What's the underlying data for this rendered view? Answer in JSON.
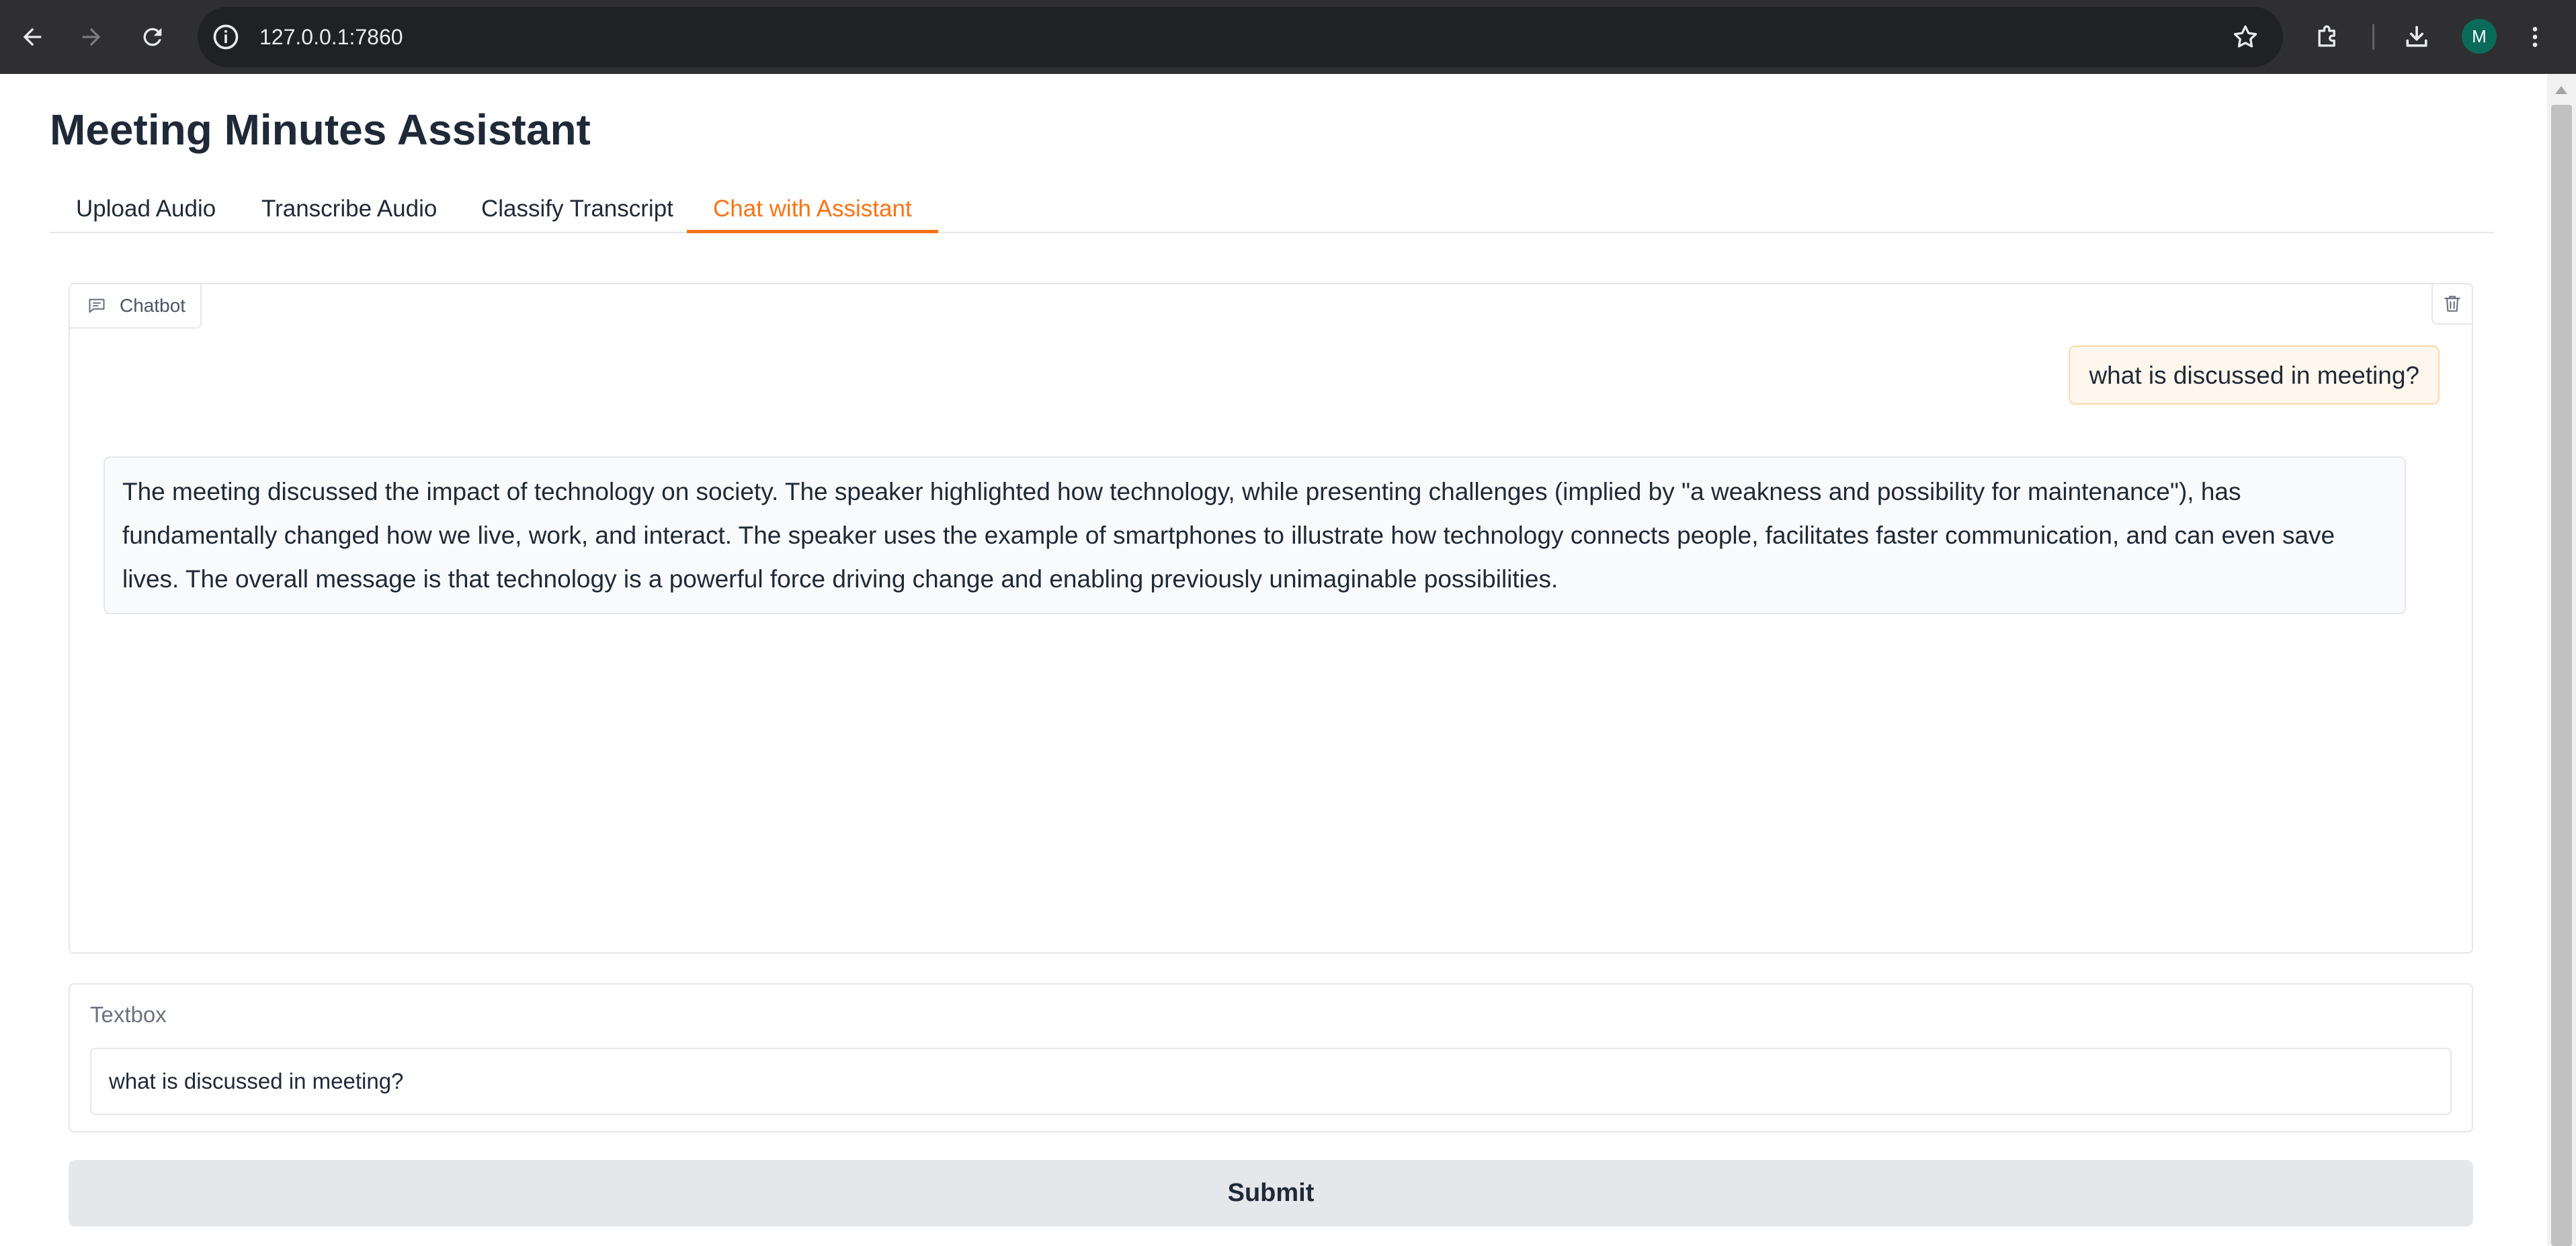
{
  "browser": {
    "url": "127.0.0.1:7860",
    "avatar_letter": "M",
    "icons": [
      "back-arrow-icon",
      "forward-arrow-icon",
      "reload-icon",
      "site-info-icon",
      "bookmark-star-icon",
      "extensions-icon",
      "download-icon",
      "more-menu-icon"
    ]
  },
  "app": {
    "title": "Meeting Minutes Assistant"
  },
  "tabs": [
    {
      "label": "Upload Audio",
      "active": false
    },
    {
      "label": "Transcribe Audio",
      "active": false
    },
    {
      "label": "Classify Transcript",
      "active": false
    },
    {
      "label": "Chat with Assistant",
      "active": true
    }
  ],
  "chatbot": {
    "label": "Chatbot",
    "messages": [
      {
        "role": "user",
        "text": "what is discussed in meeting?"
      },
      {
        "role": "assistant",
        "text": "The meeting discussed the impact of technology on society. The speaker highlighted how technology, while presenting challenges (implied by \"a weakness and possibility for maintenance\"), has fundamentally changed how we live, work, and interact. The speaker uses the example of smartphones to illustrate how technology connects people, facilitates faster communication, and can even save lives. The overall message is that technology is a powerful force driving change and enabling previously unimaginable possibilities."
      }
    ]
  },
  "textbox": {
    "label": "Textbox",
    "value": "what is discussed in meeting?"
  },
  "submit": {
    "label": "Submit"
  },
  "colors": {
    "accent": "#f97316",
    "browser_chrome": "#2f2f31",
    "user_bubble": "#fff7ed",
    "button_bg": "#e5e7eb"
  }
}
